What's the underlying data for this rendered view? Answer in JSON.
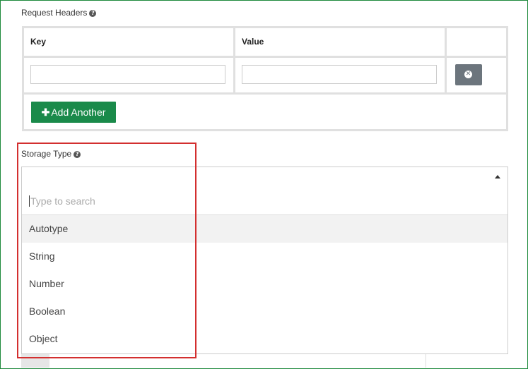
{
  "request_headers": {
    "label": "Request Headers",
    "columns": [
      "Key",
      "Value",
      ""
    ],
    "key_value": "",
    "value_value": "",
    "add_label": "Add Another"
  },
  "storage_type": {
    "label": "Storage Type",
    "selected": "",
    "search_placeholder": "Type to search",
    "options": [
      "Autotype",
      "String",
      "Number",
      "Boolean",
      "Object"
    ]
  },
  "colors": {
    "frame_border": "#1e8a3c",
    "add_button": "#1a8a4a",
    "remove_button": "#6c757d",
    "highlight": "#d32f2f"
  },
  "icons": [
    "question-circle-icon",
    "remove-circle-icon",
    "plus-icon",
    "caret-up-icon"
  ]
}
